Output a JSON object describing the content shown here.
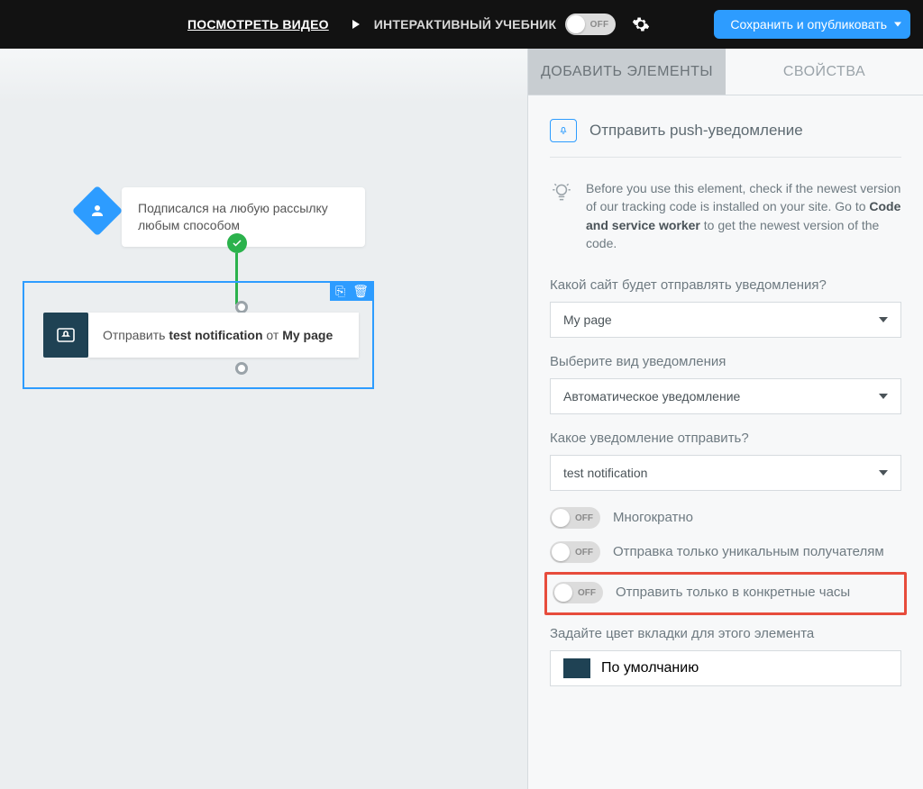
{
  "topbar": {
    "video_link": "ПОСМОТРЕТЬ ВИДЕО",
    "tutorial_label": "ИНТЕРАКТИВНЫЙ УЧЕБНИК",
    "tutorial_toggle": "OFF",
    "publish_label": "Сохранить и опубликовать"
  },
  "canvas": {
    "trigger_text": "Подписался на любую рассылку любым способом",
    "action_prefix": "Отправить ",
    "action_notification": "test notification",
    "action_middle": " от ",
    "action_page": "My page"
  },
  "tabs": {
    "add": "ДОБАВИТЬ ЭЛЕМЕНТЫ",
    "props": "СВОЙСТВА"
  },
  "panel": {
    "title": "Отправить push-уведомление",
    "hint_before": "Before you use this element, check if the newest version of our tracking code is installed on your site. Go to ",
    "hint_bold": "Code and service worker",
    "hint_after": " to get the newest version of the code.",
    "q_site": "Какой сайт будет отправлять уведомления?",
    "site_value": "My page",
    "q_type": "Выберите вид уведомления",
    "type_value": "Автоматическое уведомление",
    "q_which": "Какое уведомление отправить?",
    "which_value": "test notification",
    "t_multi": "Многократно",
    "t_unique": "Отправка только уникальным получателям",
    "t_hours": "Отправить только в конкретные часы",
    "q_color": "Задайте цвет вкладки для этого элемента",
    "color_value": "По умолчанию",
    "off": "OFF"
  }
}
